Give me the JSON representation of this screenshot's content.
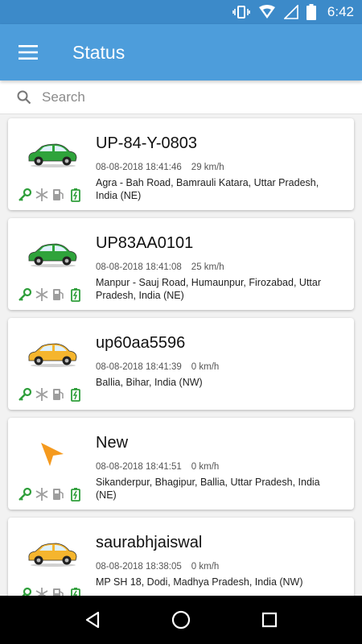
{
  "status_bar": {
    "time": "6:42"
  },
  "app_bar": {
    "title": "Status"
  },
  "search": {
    "placeholder": "Search"
  },
  "vehicles": [
    {
      "name": "UP-84-Y-0803",
      "timestamp": "08-08-2018 18:41:46",
      "speed": "29 km/h",
      "address": "Agra - Bah Road, Bamrauli Katara, Uttar Pradesh, India (NE)",
      "icon": "green-car-icon"
    },
    {
      "name": "UP83AA0101",
      "timestamp": "08-08-2018 18:41:08",
      "speed": "25 km/h",
      "address": "Manpur - Sauj Road, Humaunpur, Firozabad, Uttar Pradesh,  India (NE)",
      "icon": "green-car-icon"
    },
    {
      "name": "up60aa5596",
      "timestamp": "08-08-2018 18:41:39",
      "speed": "0 km/h",
      "address": "Ballia, Bihar, India (NW)",
      "icon": "yellow-car-icon"
    },
    {
      "name": "New",
      "timestamp": "08-08-2018 18:41:51",
      "speed": "0 km/h",
      "address": "Sikanderpur, Bhagipur, Ballia, Uttar Pradesh, India (NE)",
      "icon": "orange-arrow-icon"
    },
    {
      "name": "saurabhjaiswal",
      "timestamp": "08-08-2018 18:38:05",
      "speed": "0 km/h",
      "address": "MP SH 18, Dodi, Madhya Pradesh,  India (NW)",
      "icon": "yellow-car-icon"
    }
  ],
  "colors": {
    "status_bar": "#3c8ac9",
    "app_bar": "#4d9ddb",
    "green_badge": "#2e9e3a",
    "grey_badge": "#9e9e9e",
    "car_green": "#2fa33b",
    "car_yellow": "#f5b52e",
    "arrow_orange": "#f59a1e"
  }
}
